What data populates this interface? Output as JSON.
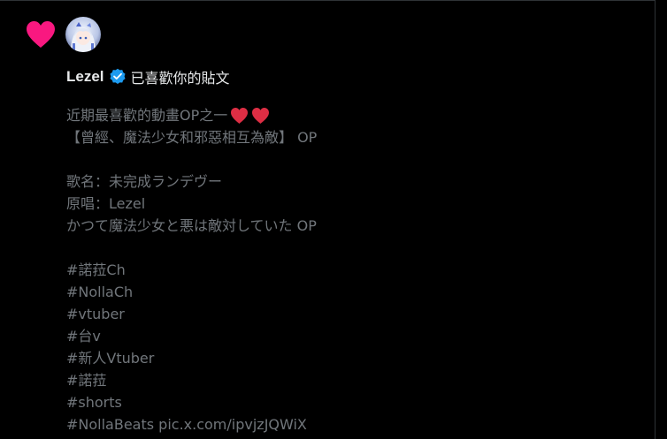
{
  "notification": {
    "type_icon": "heart-icon",
    "type_icon_color": "#f91880",
    "avatar_icon": "user-avatar",
    "user_name": "Lezel",
    "verified_icon": "verified-badge-icon",
    "verified_color": "#1d9bf0",
    "action_text": "已喜歡你的貼文"
  },
  "post": {
    "lines": [
      "近期最喜歡的動畫OP之一",
      "【曾經、魔法少女和邪惡相互為敵】 OP",
      "",
      "歌名：未完成ランデヴー",
      "原唱：Lezel",
      "かつて魔法少女と悪は敵対していた OP",
      "",
      "#諾菈Ch",
      "#NollaCh",
      "#vtuber",
      "#台v",
      "#新人Vtuber",
      "#諾菈",
      "#shorts",
      "#NollaBeats pic.x.com/ipvjzJQWiX"
    ],
    "emoji_icon": "red-heart-emoji",
    "emoji_color": "#dd2e44"
  },
  "colors": {
    "background": "#000000",
    "primary_text": "#e7e9ea",
    "secondary_text": "#71767b",
    "border": "#2f3336"
  }
}
